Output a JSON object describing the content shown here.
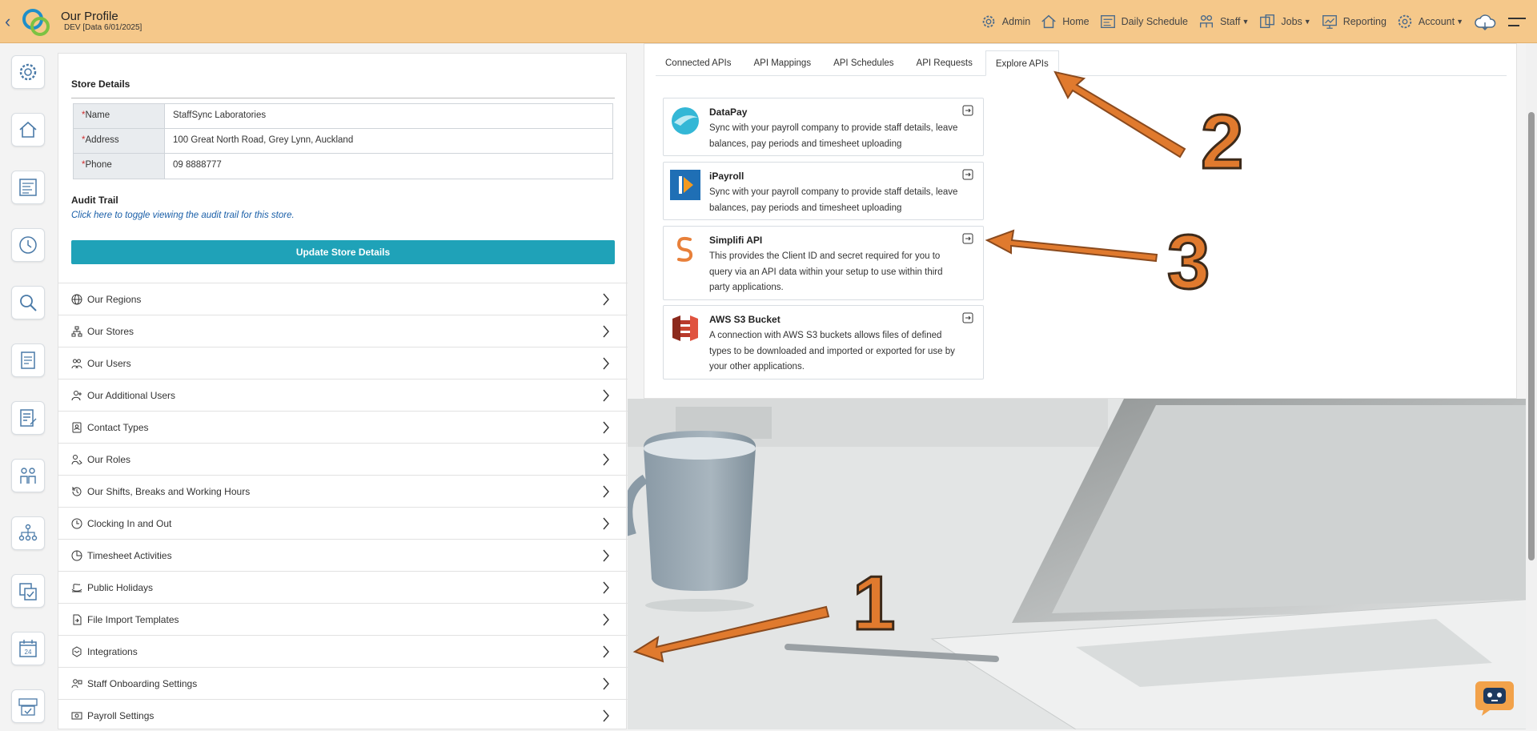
{
  "header": {
    "title": "Our Profile",
    "subtitle": "DEV [Data 6/01/2025]",
    "nav": [
      {
        "label": "Admin",
        "icon": "gear-icon",
        "caret": false
      },
      {
        "label": "Home",
        "icon": "home-icon",
        "caret": false
      },
      {
        "label": "Daily Schedule",
        "icon": "schedule-icon",
        "caret": false
      },
      {
        "label": "Staff",
        "icon": "staff-icon",
        "caret": true
      },
      {
        "label": "Jobs",
        "icon": "jobs-icon",
        "caret": true
      },
      {
        "label": "Reporting",
        "icon": "reporting-icon",
        "caret": false
      },
      {
        "label": "Account",
        "icon": "account-gear-icon",
        "caret": true
      }
    ],
    "colors": {
      "bar": "#f5c88a",
      "accent": "#1fa2b8"
    }
  },
  "rail": {
    "icons": [
      "settings-icon",
      "home-icon",
      "schedule-grid-icon",
      "timer-icon",
      "search-icon",
      "document-icon",
      "edit-list-icon",
      "team-icon",
      "hierarchy-icon",
      "checklist-icon",
      "calendar-24-icon",
      "timesheet-icon"
    ]
  },
  "store": {
    "section_title": "Store Details",
    "fields": [
      {
        "label": "Name",
        "value": "StaffSync Laboratories"
      },
      {
        "label": "Address",
        "value": "100 Great North Road, Grey Lynn, Auckland"
      },
      {
        "label": "Phone",
        "value": "09 8888777"
      }
    ],
    "required_mark": "*",
    "audit_title": "Audit Trail",
    "audit_link": "Click here to toggle viewing the audit trail for this store.",
    "update_button": "Update Store Details"
  },
  "menu": [
    {
      "label": "Our Regions",
      "icon": "globe-icon"
    },
    {
      "label": "Our Stores",
      "icon": "sitemap-icon"
    },
    {
      "label": "Our Users",
      "icon": "users-icon"
    },
    {
      "label": "Our Additional Users",
      "icon": "user-plus-icon"
    },
    {
      "label": "Contact Types",
      "icon": "contact-card-icon"
    },
    {
      "label": "Our Roles",
      "icon": "user-role-icon"
    },
    {
      "label": "Our Shifts, Breaks and Working Hours",
      "icon": "history-icon"
    },
    {
      "label": "Clocking In and Out",
      "icon": "clock-icon"
    },
    {
      "label": "Timesheet Activities",
      "icon": "pie-clock-icon"
    },
    {
      "label": "Public Holidays",
      "icon": "holiday-icon"
    },
    {
      "label": "File Import Templates",
      "icon": "file-import-icon"
    },
    {
      "label": "Integrations",
      "icon": "integrations-icon"
    },
    {
      "label": "Staff Onboarding Settings",
      "icon": "onboarding-icon"
    },
    {
      "label": "Payroll Settings",
      "icon": "payroll-icon"
    }
  ],
  "tabs": [
    "Connected APIs",
    "API Mappings",
    "API Schedules",
    "API Requests",
    "Explore APIs"
  ],
  "active_tab": "Explore APIs",
  "apis": [
    {
      "name": "DataPay",
      "desc": "Sync with your payroll company to provide staff details, leave balances, pay periods and timesheet uploading",
      "logo": "datapay-logo"
    },
    {
      "name": "iPayroll",
      "desc": "Sync with your payroll company to provide staff details, leave balances, pay periods and timesheet uploading",
      "logo": "ipayroll-logo"
    },
    {
      "name": "Simplifi API",
      "desc": "This provides the Client ID and secret required for you to query via an API data within your setup to use within third party applications.",
      "logo": "simplifi-logo"
    },
    {
      "name": "AWS S3 Bucket",
      "desc": "A connection with AWS S3 buckets allows files of defined types to be downloaded and imported or exported for use by your other applications.",
      "logo": "aws-s3-logo"
    }
  ],
  "annotations": [
    "1",
    "2",
    "3"
  ]
}
